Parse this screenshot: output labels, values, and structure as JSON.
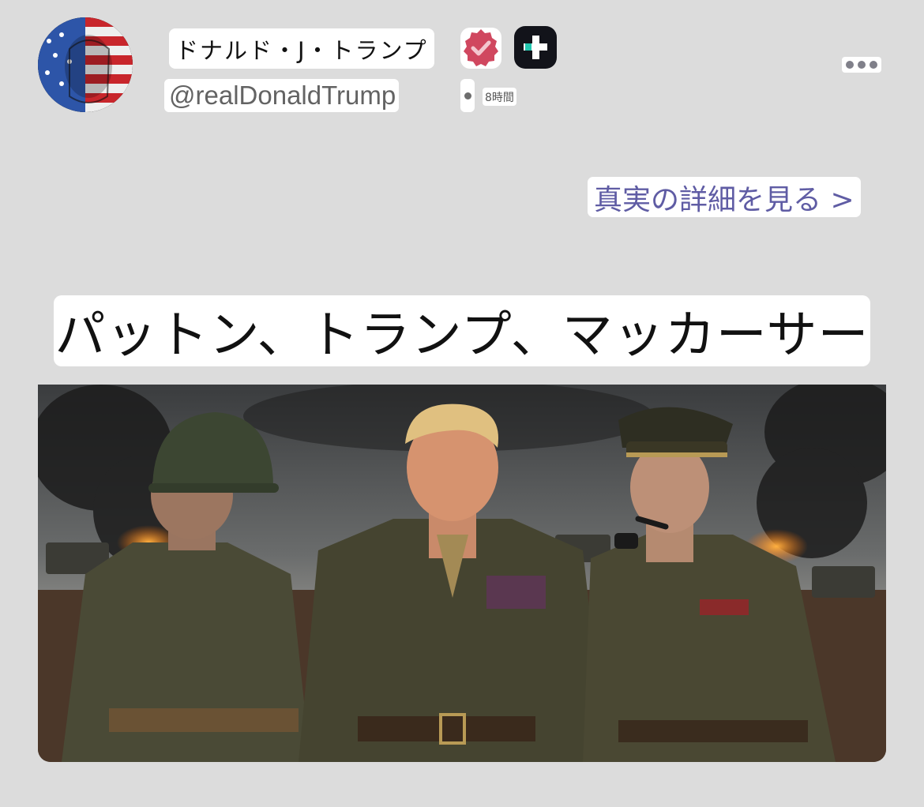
{
  "post": {
    "display_name": "ドナルド・J・トランプ",
    "handle": "@realDonaldTrump",
    "timestamp": "8時間",
    "view_truth_link": "真実の詳細を見る >",
    "headline": "パットン、トランプ、マッカーサー",
    "image_description_icon": "military-portrait-image"
  },
  "icons": {
    "verified": "verified-badge-icon",
    "app": "truth-social-plus-icon",
    "more": "more-options-icon"
  },
  "colors": {
    "background": "#dcdcdc",
    "link": "#5f5ca4",
    "verified_badge": "#d0475f"
  }
}
